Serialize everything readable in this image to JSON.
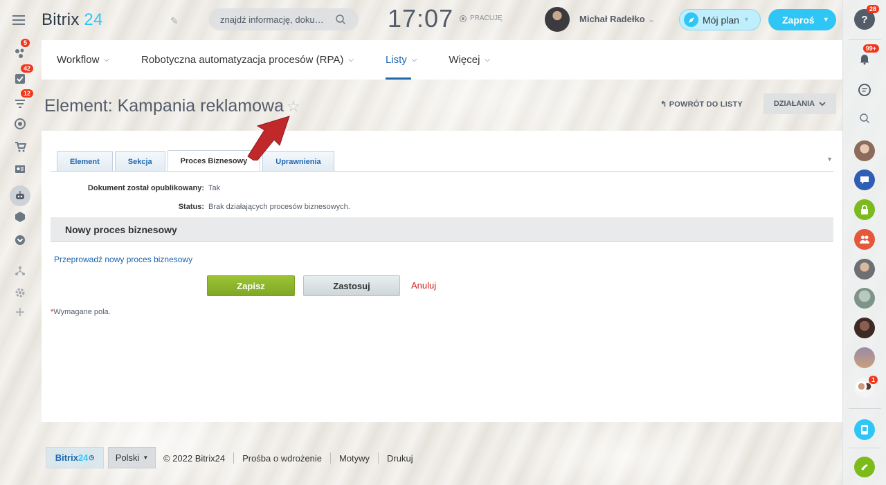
{
  "left_sidebar": {
    "items": [
      {
        "icon": "activity-stream-icon",
        "badge": "5"
      },
      {
        "icon": "tasks-icon",
        "badge": "42"
      },
      {
        "icon": "crm-filter-icon",
        "badge": "12"
      },
      {
        "icon": "target-icon",
        "badge": ""
      },
      {
        "icon": "cart-icon",
        "badge": ""
      },
      {
        "icon": "contact-card-icon",
        "badge": ""
      },
      {
        "icon": "robot-icon",
        "badge": ""
      },
      {
        "icon": "box-icon",
        "badge": ""
      },
      {
        "icon": "chevron-circle-icon",
        "badge": ""
      },
      {
        "icon": "sitemap-icon",
        "badge": ""
      },
      {
        "icon": "gear-icon",
        "badge": ""
      },
      {
        "icon": "plus-icon",
        "badge": ""
      }
    ]
  },
  "header": {
    "logo_text": "Bitrix",
    "logo_num": "24",
    "search_placeholder": "znajdź informację, doku…",
    "clock": "17:07",
    "work_status": "PRACUJĘ",
    "user_name": "Michał Radełko",
    "plan_label": "Mój plan",
    "invite_label": "Zaproś"
  },
  "nav": {
    "items": [
      {
        "label": "Workflow",
        "active": false
      },
      {
        "label": "Robotyczna automatyzacja procesów (RPA)",
        "active": false
      },
      {
        "label": "Listy",
        "active": true
      },
      {
        "label": "Więcej",
        "active": false
      }
    ]
  },
  "page": {
    "title": "Element: Kampania reklamowa",
    "back_link": "POWRÓT DO LISTY",
    "actions_label": "DZIAŁANIA"
  },
  "tabs": [
    {
      "label": "Element",
      "active": false
    },
    {
      "label": "Sekcja",
      "active": false
    },
    {
      "label": "Proces Biznesowy",
      "active": true
    },
    {
      "label": "Uprawnienia",
      "active": false
    }
  ],
  "form": {
    "published_label": "Dokument został opublikowany:",
    "published_value": "Tak",
    "status_label": "Status:",
    "status_value": "Brak działających procesów biznesowych.",
    "section_title": "Nowy proces biznesowy",
    "start_link": "Przeprowadź nowy proces biznesowy",
    "save_label": "Zapisz",
    "apply_label": "Zastosuj",
    "cancel_label": "Anuluj",
    "required_star": "*",
    "required_note": "Wymagane pola."
  },
  "footer": {
    "logo_text": "Bitrix",
    "logo_num": "24",
    "language": "Polski",
    "copyright": "© 2022 Bitrix24",
    "links": [
      "Prośba o wdrożenie",
      "Motywy",
      "Drukuj"
    ]
  },
  "right_sidebar": {
    "help_badge": "28",
    "notifications_badge": "99+",
    "recent_chat_badge": "1"
  },
  "colors": {
    "accent": "#2fc6f6",
    "link": "#2067b0",
    "save_green": "#8fbc2f",
    "cancel_red": "#d12020",
    "badge_red": "#f1361b",
    "annotation_arrow": "#c0282a"
  }
}
